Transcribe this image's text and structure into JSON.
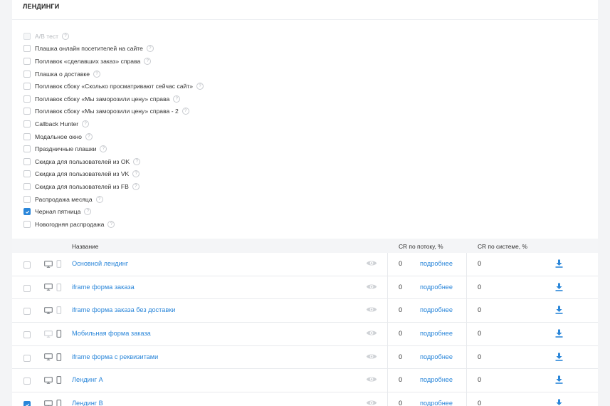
{
  "section": {
    "title": "ЛЕНДИНГИ"
  },
  "options": [
    {
      "label": "A/B тест",
      "checked": false,
      "disabled": true
    },
    {
      "label": "Плашка онлайн посетителей на сайте",
      "checked": false,
      "disabled": false
    },
    {
      "label": "Поплавок «сделавших заказ» справа",
      "checked": false,
      "disabled": false
    },
    {
      "label": "Плашка о доставке",
      "checked": false,
      "disabled": false
    },
    {
      "label": "Поплавок сбоку «Сколько просматривают сейчас сайт»",
      "checked": false,
      "disabled": false
    },
    {
      "label": "Поплавок сбоку «Мы заморозили цену» справа",
      "checked": false,
      "disabled": false
    },
    {
      "label": "Поплавок сбоку «Мы заморозили цену» справа - 2",
      "checked": false,
      "disabled": false
    },
    {
      "label": "Callback Hunter",
      "checked": false,
      "disabled": false
    },
    {
      "label": "Модальное окно",
      "checked": false,
      "disabled": false
    },
    {
      "label": "Праздничные плашки",
      "checked": false,
      "disabled": false
    },
    {
      "label": "Скидка для пользователей из OK",
      "checked": false,
      "disabled": false
    },
    {
      "label": "Скидка для пользователей из VK",
      "checked": false,
      "disabled": false
    },
    {
      "label": "Скидка для пользователей из FB",
      "checked": false,
      "disabled": false
    },
    {
      "label": "Распродажа месяца",
      "checked": false,
      "disabled": false
    },
    {
      "label": "Черная пятница",
      "checked": true,
      "disabled": false
    },
    {
      "label": "Новогодняя распродажа",
      "checked": false,
      "disabled": false
    }
  ],
  "table": {
    "headers": {
      "name": "Название",
      "cr_flow": "CR по потоку, %",
      "cr_system": "CR по системе, %"
    },
    "more_label": "подробнее",
    "rows": [
      {
        "name": "Основной лендинг",
        "checked": false,
        "desktop": true,
        "mobile": false,
        "cr_flow": "0",
        "cr_system": "0"
      },
      {
        "name": "iframe форма заказа",
        "checked": false,
        "desktop": true,
        "mobile": false,
        "cr_flow": "0",
        "cr_system": "0"
      },
      {
        "name": "iframe форма заказа без доставки",
        "checked": false,
        "desktop": true,
        "mobile": false,
        "cr_flow": "0",
        "cr_system": "0"
      },
      {
        "name": "Мобильная форма заказа",
        "checked": false,
        "desktop": false,
        "mobile": true,
        "cr_flow": "0",
        "cr_system": "0"
      },
      {
        "name": "iframe форма с реквизитами",
        "checked": false,
        "desktop": true,
        "mobile": true,
        "cr_flow": "0",
        "cr_system": "0"
      },
      {
        "name": "Лендинг A",
        "checked": false,
        "desktop": true,
        "mobile": true,
        "cr_flow": "0",
        "cr_system": "0"
      },
      {
        "name": "Лендинг B",
        "checked": true,
        "desktop": true,
        "mobile": true,
        "cr_flow": "0",
        "cr_system": "0"
      }
    ]
  },
  "icons": {
    "help": "question-circle-icon",
    "preview": "eye-icon",
    "download": "download-icon",
    "desktop": "monitor-icon",
    "mobile": "phone-icon",
    "check": "check-icon"
  },
  "colors": {
    "accent": "#2a86d9",
    "header_bg": "#f4f5f7"
  }
}
